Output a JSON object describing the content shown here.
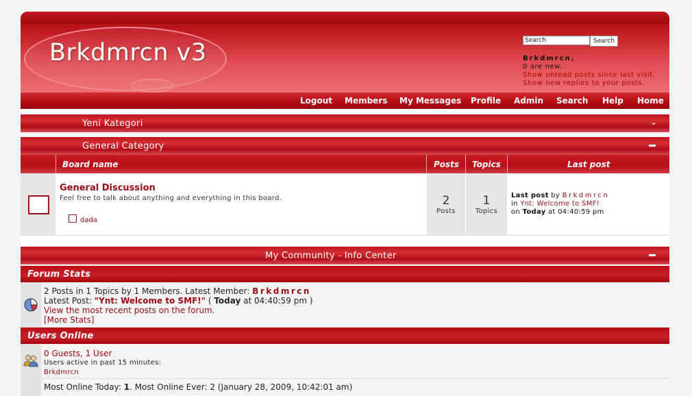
{
  "header": {
    "logo": "Brkdmrcn v3",
    "search_placeholder": "Search",
    "search_button": "Search",
    "username": "Brkdmrcn,",
    "new_count": "0 are new.",
    "unread_link": "Show unread posts since last visit.",
    "replies_link": "Show new replies to your posts."
  },
  "nav": [
    "Logout",
    "Members",
    "My Messages",
    "Profile",
    "Admin",
    "Search",
    "Help",
    "Home"
  ],
  "categories": [
    {
      "title": "Yeni Kategori"
    },
    {
      "title": "General Category"
    }
  ],
  "table": {
    "col_board": "Board name",
    "col_posts": "Posts",
    "col_topics": "Topics",
    "col_last": "Last post",
    "board_name": "General Discussion",
    "board_desc": "Feel free to talk about anything and everything in this board.",
    "child_board": "dada",
    "posts_num": "2",
    "posts_lbl": "Posts",
    "topics_num": "1",
    "topics_lbl": "Topics",
    "last_post_label": "Last post",
    "by": "by",
    "last_author": "Brkdmrcn",
    "in": "in",
    "last_topic": "Ynt: Welcome to SMF!",
    "on": "on",
    "today": "Today",
    "last_time": "at 04:40:59 pm"
  },
  "info_center": {
    "title": "My Community - Info Center",
    "forum_stats_title": "Forum Stats",
    "stats_line": "2 Posts in 1 Topics by 1 Members. Latest Member:",
    "latest_member": "Brkdmrcn",
    "latest_post_label": "Latest Post:",
    "latest_post_title": "\"Ynt: Welcome to SMF!\"",
    "latest_post_open": "(",
    "latest_post_today": "Today",
    "latest_post_time": "at 04:40:59 pm )",
    "recent_link": "View the most recent posts on the forum.",
    "more_stats": "[More Stats]",
    "users_online_title": "Users Online",
    "guests_users": "0 Guests, 1 User",
    "active_note": "Users active in past 15 minutes:",
    "active_user": "Brkdmrcn",
    "most_online_a": "Most Online Today:",
    "most_online_today": "1",
    "most_online_b": ". Most Online Ever: 2 (January 28, 2009, 10:42:01 am)"
  }
}
